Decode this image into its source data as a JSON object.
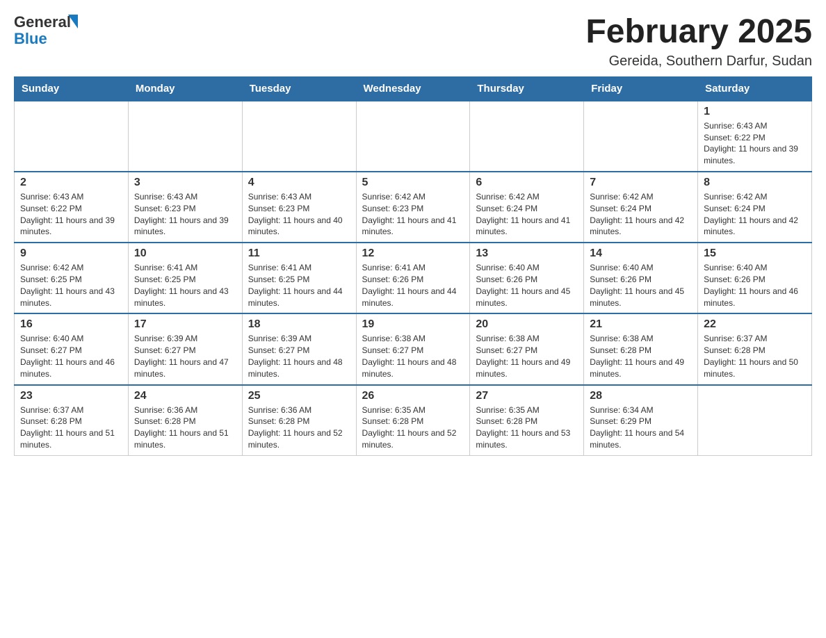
{
  "header": {
    "logo": {
      "text_general": "General",
      "text_blue": "Blue"
    },
    "title": "February 2025",
    "subtitle": "Gereida, Southern Darfur, Sudan"
  },
  "days_of_week": [
    "Sunday",
    "Monday",
    "Tuesday",
    "Wednesday",
    "Thursday",
    "Friday",
    "Saturday"
  ],
  "weeks": [
    [
      {
        "day": "",
        "info": ""
      },
      {
        "day": "",
        "info": ""
      },
      {
        "day": "",
        "info": ""
      },
      {
        "day": "",
        "info": ""
      },
      {
        "day": "",
        "info": ""
      },
      {
        "day": "",
        "info": ""
      },
      {
        "day": "1",
        "info": "Sunrise: 6:43 AM\nSunset: 6:22 PM\nDaylight: 11 hours and 39 minutes."
      }
    ],
    [
      {
        "day": "2",
        "info": "Sunrise: 6:43 AM\nSunset: 6:22 PM\nDaylight: 11 hours and 39 minutes."
      },
      {
        "day": "3",
        "info": "Sunrise: 6:43 AM\nSunset: 6:23 PM\nDaylight: 11 hours and 39 minutes."
      },
      {
        "day": "4",
        "info": "Sunrise: 6:43 AM\nSunset: 6:23 PM\nDaylight: 11 hours and 40 minutes."
      },
      {
        "day": "5",
        "info": "Sunrise: 6:42 AM\nSunset: 6:23 PM\nDaylight: 11 hours and 41 minutes."
      },
      {
        "day": "6",
        "info": "Sunrise: 6:42 AM\nSunset: 6:24 PM\nDaylight: 11 hours and 41 minutes."
      },
      {
        "day": "7",
        "info": "Sunrise: 6:42 AM\nSunset: 6:24 PM\nDaylight: 11 hours and 42 minutes."
      },
      {
        "day": "8",
        "info": "Sunrise: 6:42 AM\nSunset: 6:24 PM\nDaylight: 11 hours and 42 minutes."
      }
    ],
    [
      {
        "day": "9",
        "info": "Sunrise: 6:42 AM\nSunset: 6:25 PM\nDaylight: 11 hours and 43 minutes."
      },
      {
        "day": "10",
        "info": "Sunrise: 6:41 AM\nSunset: 6:25 PM\nDaylight: 11 hours and 43 minutes."
      },
      {
        "day": "11",
        "info": "Sunrise: 6:41 AM\nSunset: 6:25 PM\nDaylight: 11 hours and 44 minutes."
      },
      {
        "day": "12",
        "info": "Sunrise: 6:41 AM\nSunset: 6:26 PM\nDaylight: 11 hours and 44 minutes."
      },
      {
        "day": "13",
        "info": "Sunrise: 6:40 AM\nSunset: 6:26 PM\nDaylight: 11 hours and 45 minutes."
      },
      {
        "day": "14",
        "info": "Sunrise: 6:40 AM\nSunset: 6:26 PM\nDaylight: 11 hours and 45 minutes."
      },
      {
        "day": "15",
        "info": "Sunrise: 6:40 AM\nSunset: 6:26 PM\nDaylight: 11 hours and 46 minutes."
      }
    ],
    [
      {
        "day": "16",
        "info": "Sunrise: 6:40 AM\nSunset: 6:27 PM\nDaylight: 11 hours and 46 minutes."
      },
      {
        "day": "17",
        "info": "Sunrise: 6:39 AM\nSunset: 6:27 PM\nDaylight: 11 hours and 47 minutes."
      },
      {
        "day": "18",
        "info": "Sunrise: 6:39 AM\nSunset: 6:27 PM\nDaylight: 11 hours and 48 minutes."
      },
      {
        "day": "19",
        "info": "Sunrise: 6:38 AM\nSunset: 6:27 PM\nDaylight: 11 hours and 48 minutes."
      },
      {
        "day": "20",
        "info": "Sunrise: 6:38 AM\nSunset: 6:27 PM\nDaylight: 11 hours and 49 minutes."
      },
      {
        "day": "21",
        "info": "Sunrise: 6:38 AM\nSunset: 6:28 PM\nDaylight: 11 hours and 49 minutes."
      },
      {
        "day": "22",
        "info": "Sunrise: 6:37 AM\nSunset: 6:28 PM\nDaylight: 11 hours and 50 minutes."
      }
    ],
    [
      {
        "day": "23",
        "info": "Sunrise: 6:37 AM\nSunset: 6:28 PM\nDaylight: 11 hours and 51 minutes."
      },
      {
        "day": "24",
        "info": "Sunrise: 6:36 AM\nSunset: 6:28 PM\nDaylight: 11 hours and 51 minutes."
      },
      {
        "day": "25",
        "info": "Sunrise: 6:36 AM\nSunset: 6:28 PM\nDaylight: 11 hours and 52 minutes."
      },
      {
        "day": "26",
        "info": "Sunrise: 6:35 AM\nSunset: 6:28 PM\nDaylight: 11 hours and 52 minutes."
      },
      {
        "day": "27",
        "info": "Sunrise: 6:35 AM\nSunset: 6:28 PM\nDaylight: 11 hours and 53 minutes."
      },
      {
        "day": "28",
        "info": "Sunrise: 6:34 AM\nSunset: 6:29 PM\nDaylight: 11 hours and 54 minutes."
      },
      {
        "day": "",
        "info": ""
      }
    ]
  ]
}
